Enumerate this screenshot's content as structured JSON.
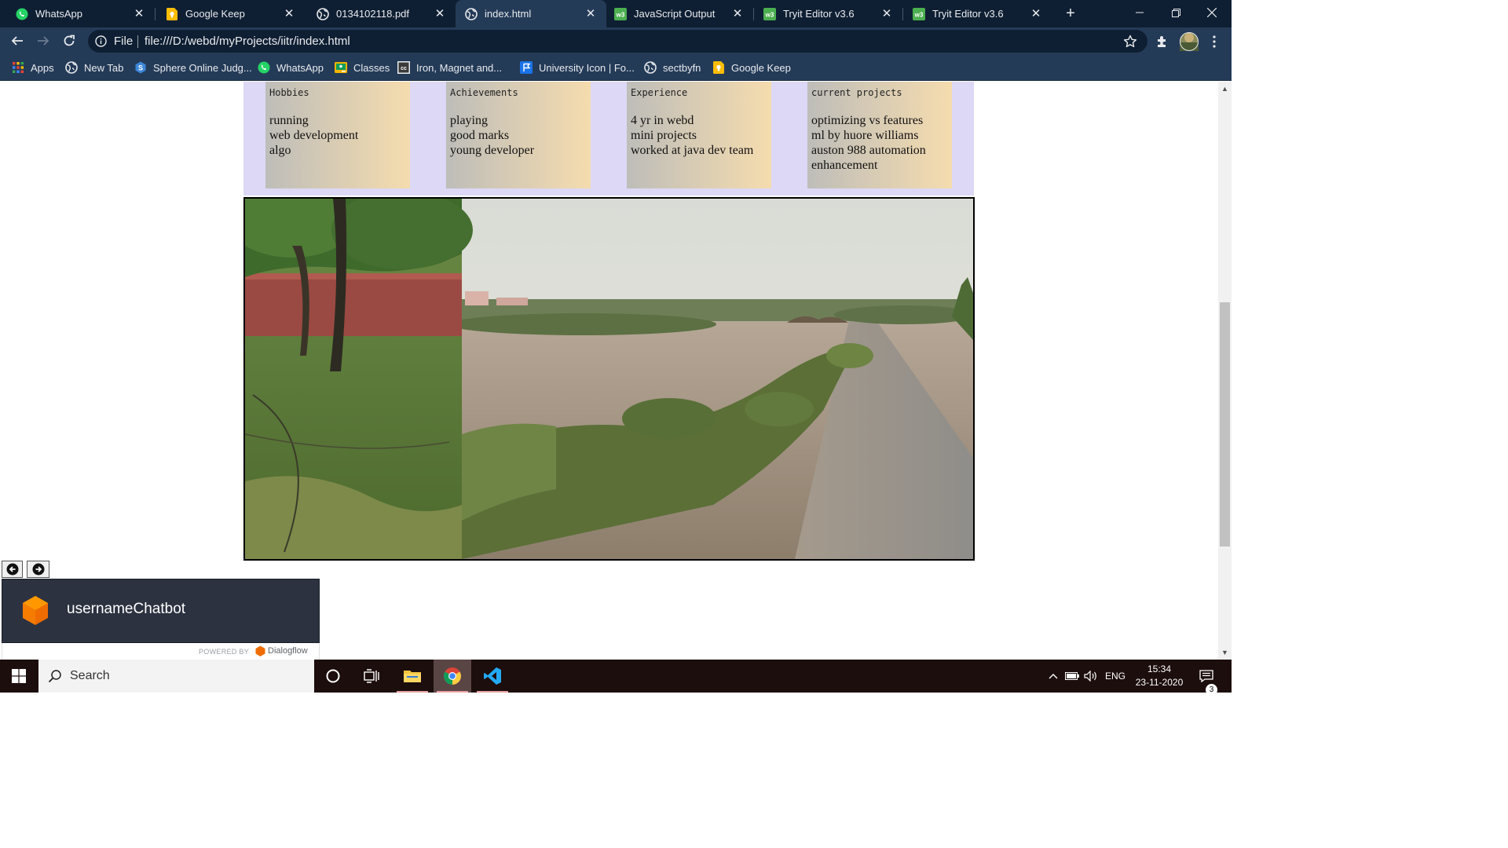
{
  "browser": {
    "tabs": [
      {
        "label": "WhatsApp",
        "icon": "whatsapp-icon",
        "active": false
      },
      {
        "label": "Google Keep",
        "icon": "google-keep-icon",
        "active": false
      },
      {
        "label": "0134102118.pdf",
        "icon": "globe-icon",
        "active": false
      },
      {
        "label": "index.html",
        "icon": "globe-icon",
        "active": true
      },
      {
        "label": "JavaScript Output",
        "icon": "w3schools-icon",
        "active": false
      },
      {
        "label": "Tryit Editor v3.6",
        "icon": "w3schools-icon",
        "active": false
      },
      {
        "label": "Tryit Editor v3.6",
        "icon": "w3schools-icon",
        "active": false
      }
    ],
    "address": {
      "scheme_label": "File",
      "url": "file:///D:/webd/myProjects/iitr/index.html"
    },
    "bookmarks": [
      {
        "label": "Apps",
        "icon": "apps-grid-icon"
      },
      {
        "label": "New Tab",
        "icon": "globe-icon"
      },
      {
        "label": "Sphere Online Judg...",
        "icon": "spoj-icon"
      },
      {
        "label": "WhatsApp",
        "icon": "whatsapp-icon"
      },
      {
        "label": "Classes",
        "icon": "classroom-icon"
      },
      {
        "label": "Iron, Magnet and...",
        "icon": "cc-icon"
      },
      {
        "label": "University Icon | Fo...",
        "icon": "flag-icon"
      },
      {
        "label": "sectbyfn",
        "icon": "globe-icon"
      },
      {
        "label": "Google Keep",
        "icon": "google-keep-icon"
      }
    ]
  },
  "page": {
    "cards": [
      {
        "title": "Hobbies",
        "items": [
          "running",
          "web development",
          "algo"
        ]
      },
      {
        "title": "Achievements",
        "items": [
          "playing",
          "good marks",
          "young developer"
        ]
      },
      {
        "title": "Experience",
        "items": [
          "4 yr in webd",
          "mini projects",
          "worked at java dev team"
        ]
      },
      {
        "title": "current projects",
        "items": [
          "optimizing vs features",
          "ml by huore williams",
          "auston 988 automation",
          "enhancement"
        ]
      }
    ],
    "chatbot": {
      "title": "usernameChatbot",
      "powered_by": "POWERED BY",
      "brand": "Dialogflow"
    }
  },
  "taskbar": {
    "search_placeholder": "Search",
    "language": "ENG",
    "time": "15:34",
    "date": "23-11-2020",
    "notification_count": "3"
  },
  "colors": {
    "tab_strip": "#0f1f33",
    "toolbar": "#243b58",
    "cards_bg": "#dcd8f6",
    "chat_header": "#2c3240",
    "taskbar": "#1c0e0d"
  }
}
